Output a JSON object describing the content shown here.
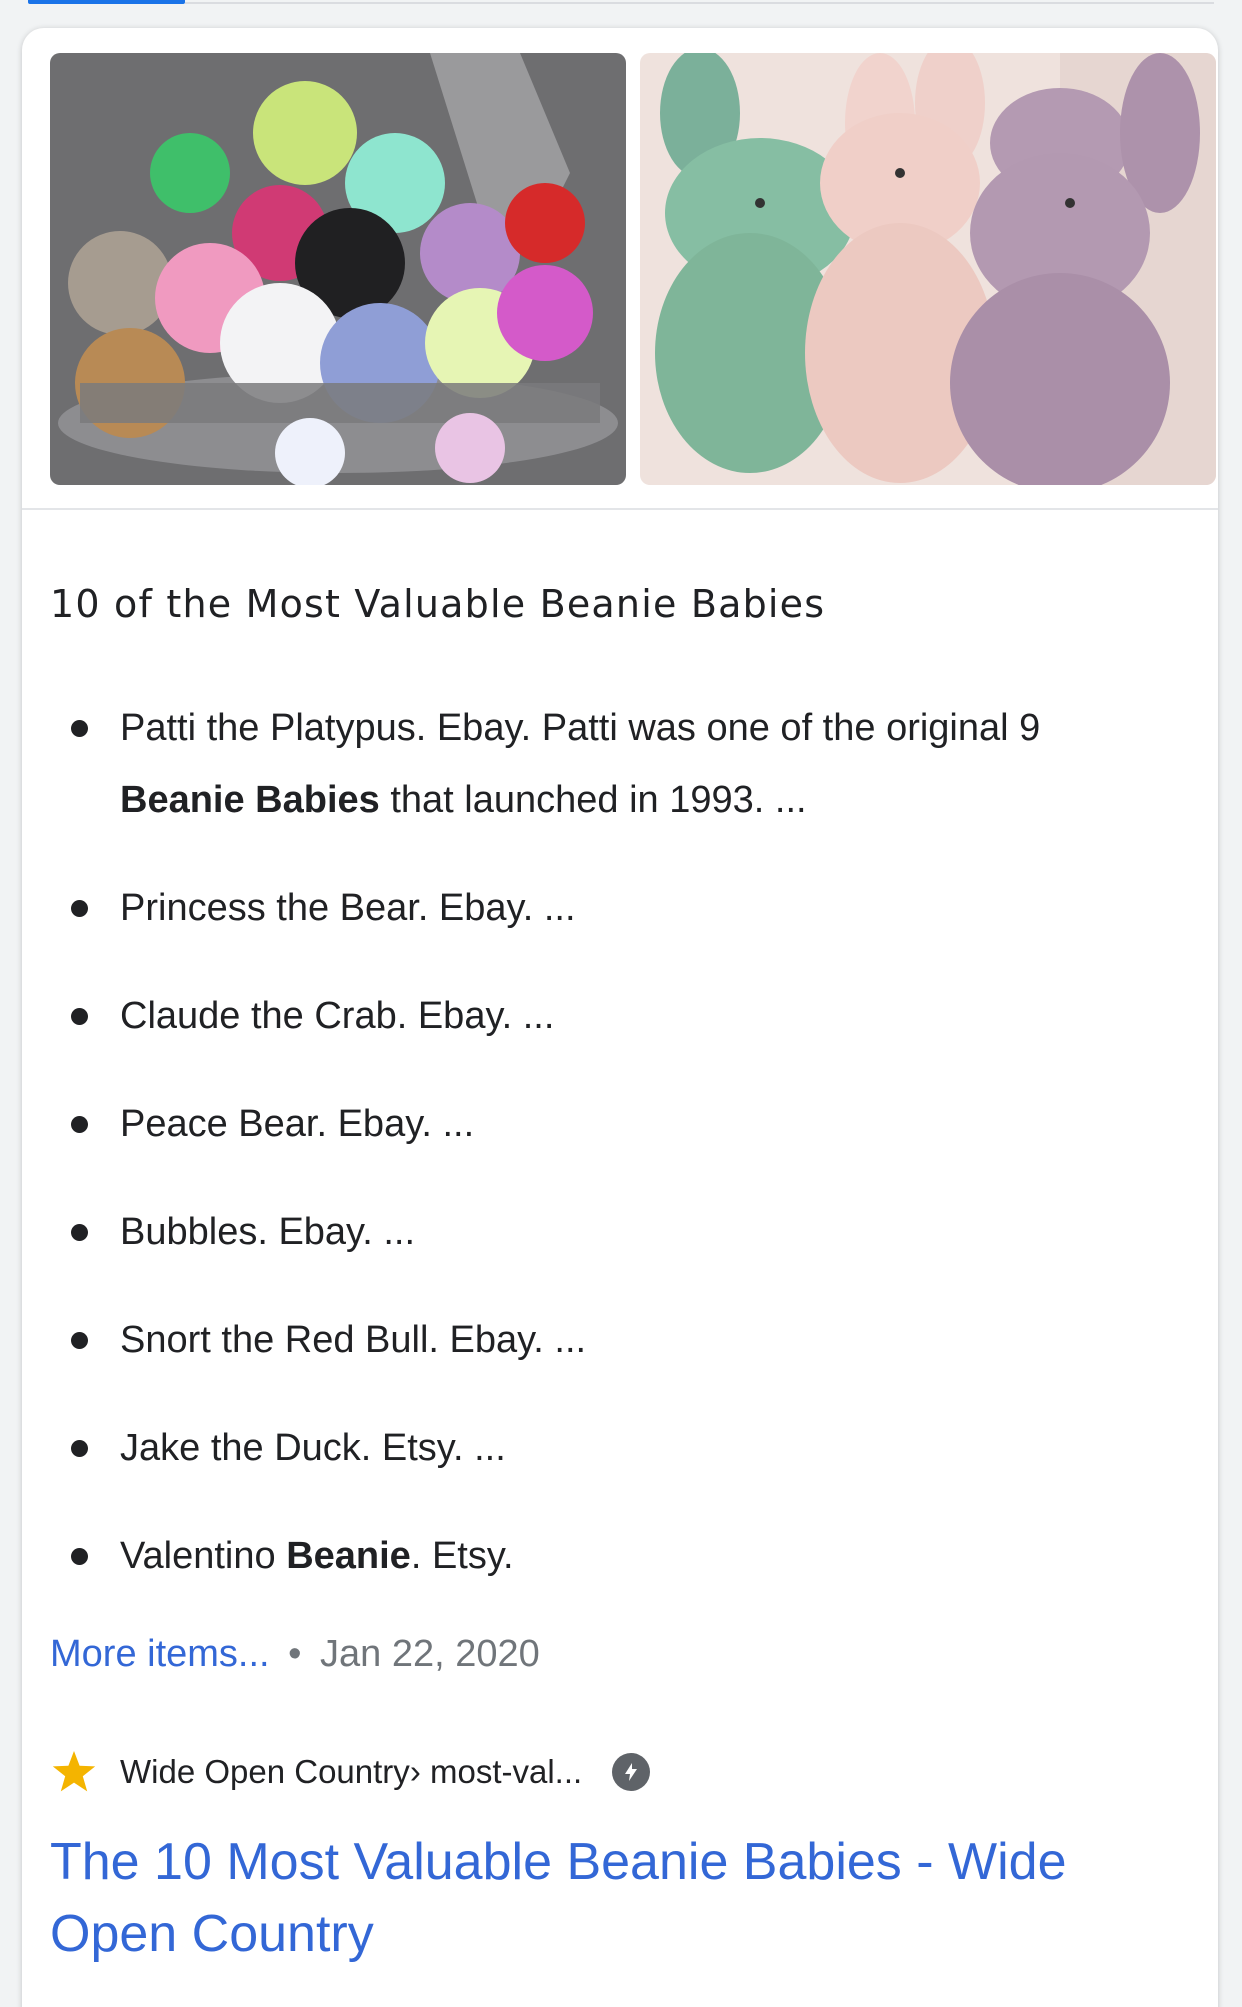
{
  "heading": "10 of the Most Valuable Beanie Babies",
  "list": [
    {
      "pre": "Patti the Platypus. Ebay. Patti was one of the original 9 ",
      "bold": "Beanie Babies",
      "post": " that launched in 1993. ..."
    },
    {
      "pre": "Princess the Bear. Ebay. ...",
      "bold": "",
      "post": ""
    },
    {
      "pre": "Claude the Crab. Ebay. ...",
      "bold": "",
      "post": ""
    },
    {
      "pre": "Peace Bear. Ebay. ...",
      "bold": "",
      "post": ""
    },
    {
      "pre": "Bubbles. Ebay. ...",
      "bold": "",
      "post": ""
    },
    {
      "pre": "Snort the Red Bull. Ebay. ...",
      "bold": "",
      "post": ""
    },
    {
      "pre": "Jake the Duck. Etsy. ...",
      "bold": "",
      "post": ""
    },
    {
      "pre": "Valentino ",
      "bold": "Beanie",
      "post": ". Etsy."
    }
  ],
  "meta": {
    "more_label": "More items...",
    "separator": "•",
    "date": "Jan 22, 2020"
  },
  "source": {
    "site": "Wide Open Country",
    "breadcrumb": " › most-val...",
    "star_icon": "star-icon",
    "amp_icon": "amp-lightning-icon"
  },
  "result_title": "The 10 Most Valuable Beanie Babies - Wide Open Country",
  "colors": {
    "link": "#3367d6",
    "text": "#202124",
    "muted": "#70757a",
    "star": "#f4b400"
  }
}
